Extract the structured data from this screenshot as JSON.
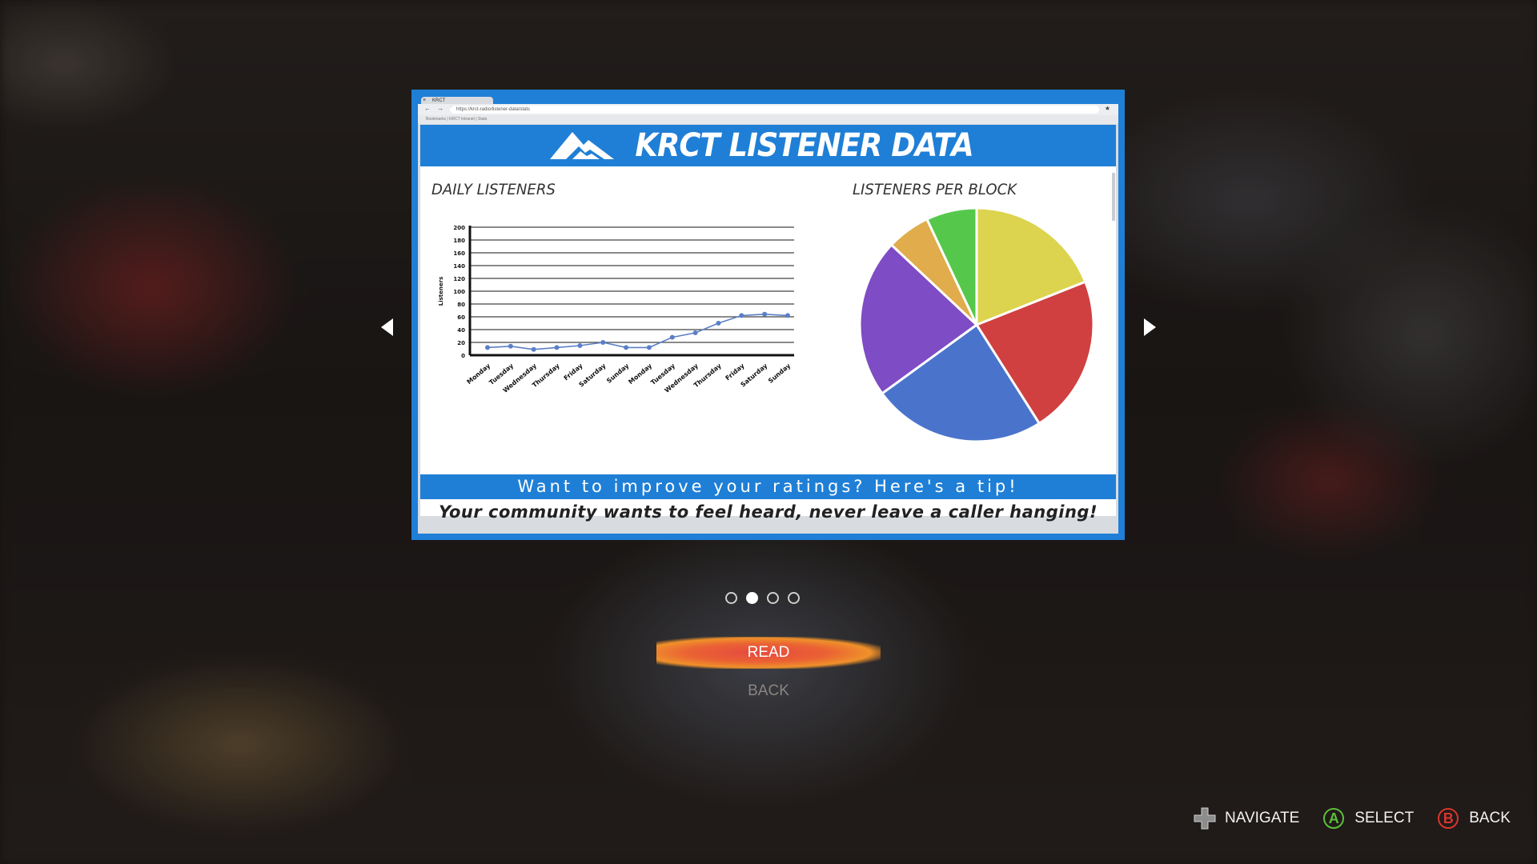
{
  "document": {
    "browser": {
      "tab_label": "KRCT",
      "nav_glyphs": "← → ⟳",
      "url_text": "https://krct-radio/listener-data/stats",
      "bookmarks_text": "Bookmarks   |   KRCT Intranet   |   Stats"
    },
    "title": "KRCT LISTENER DATA",
    "line_chart_title": "DAILY LISTENERS",
    "pie_chart_title": "LISTENERS PER BLOCK",
    "tip_heading": "Want to improve your ratings? Here's a tip!",
    "tip_text": "Your community wants to feel heard, never leave a caller hanging!"
  },
  "chart_data": [
    {
      "type": "line",
      "title": "DAILY LISTENERS",
      "ylabel": "Listeners",
      "categories": [
        "Monday",
        "Tuesday",
        "Wednesday",
        "Thursday",
        "Friday",
        "Saturday",
        "Sunday",
        "Monday",
        "Tuesday",
        "Wednesday",
        "Thursday",
        "Friday",
        "Saturday",
        "Sunday"
      ],
      "values": [
        12,
        14,
        9,
        12,
        15,
        20,
        12,
        12,
        28,
        35,
        50,
        62,
        64,
        62
      ],
      "ylim": [
        0,
        200
      ],
      "yticks": [
        0,
        20,
        40,
        60,
        80,
        100,
        120,
        140,
        160,
        180,
        200
      ],
      "grid": true,
      "color": "#5b7fc6"
    },
    {
      "type": "pie",
      "title": "LISTENERS PER BLOCK",
      "slices": [
        {
          "value": 19,
          "color": "#dcd44e"
        },
        {
          "value": 22,
          "color": "#d04040"
        },
        {
          "value": 24,
          "color": "#4a74cc"
        },
        {
          "value": 22,
          "color": "#7e4cc4"
        },
        {
          "value": 6,
          "color": "#e0ac4c"
        },
        {
          "value": 7,
          "color": "#55c84c"
        }
      ]
    }
  ],
  "carousel": {
    "page_count": 4,
    "active_page": 2
  },
  "menu": {
    "read_label": "READ",
    "back_label": "BACK"
  },
  "hints": {
    "navigate": "NAVIGATE",
    "select": "SELECT",
    "back": "BACK",
    "select_button": "A",
    "back_button": "B"
  },
  "colors": {
    "accent_blue": "#1f7fd6",
    "select_green": "#5cbf3a",
    "back_red": "#d9352f"
  }
}
